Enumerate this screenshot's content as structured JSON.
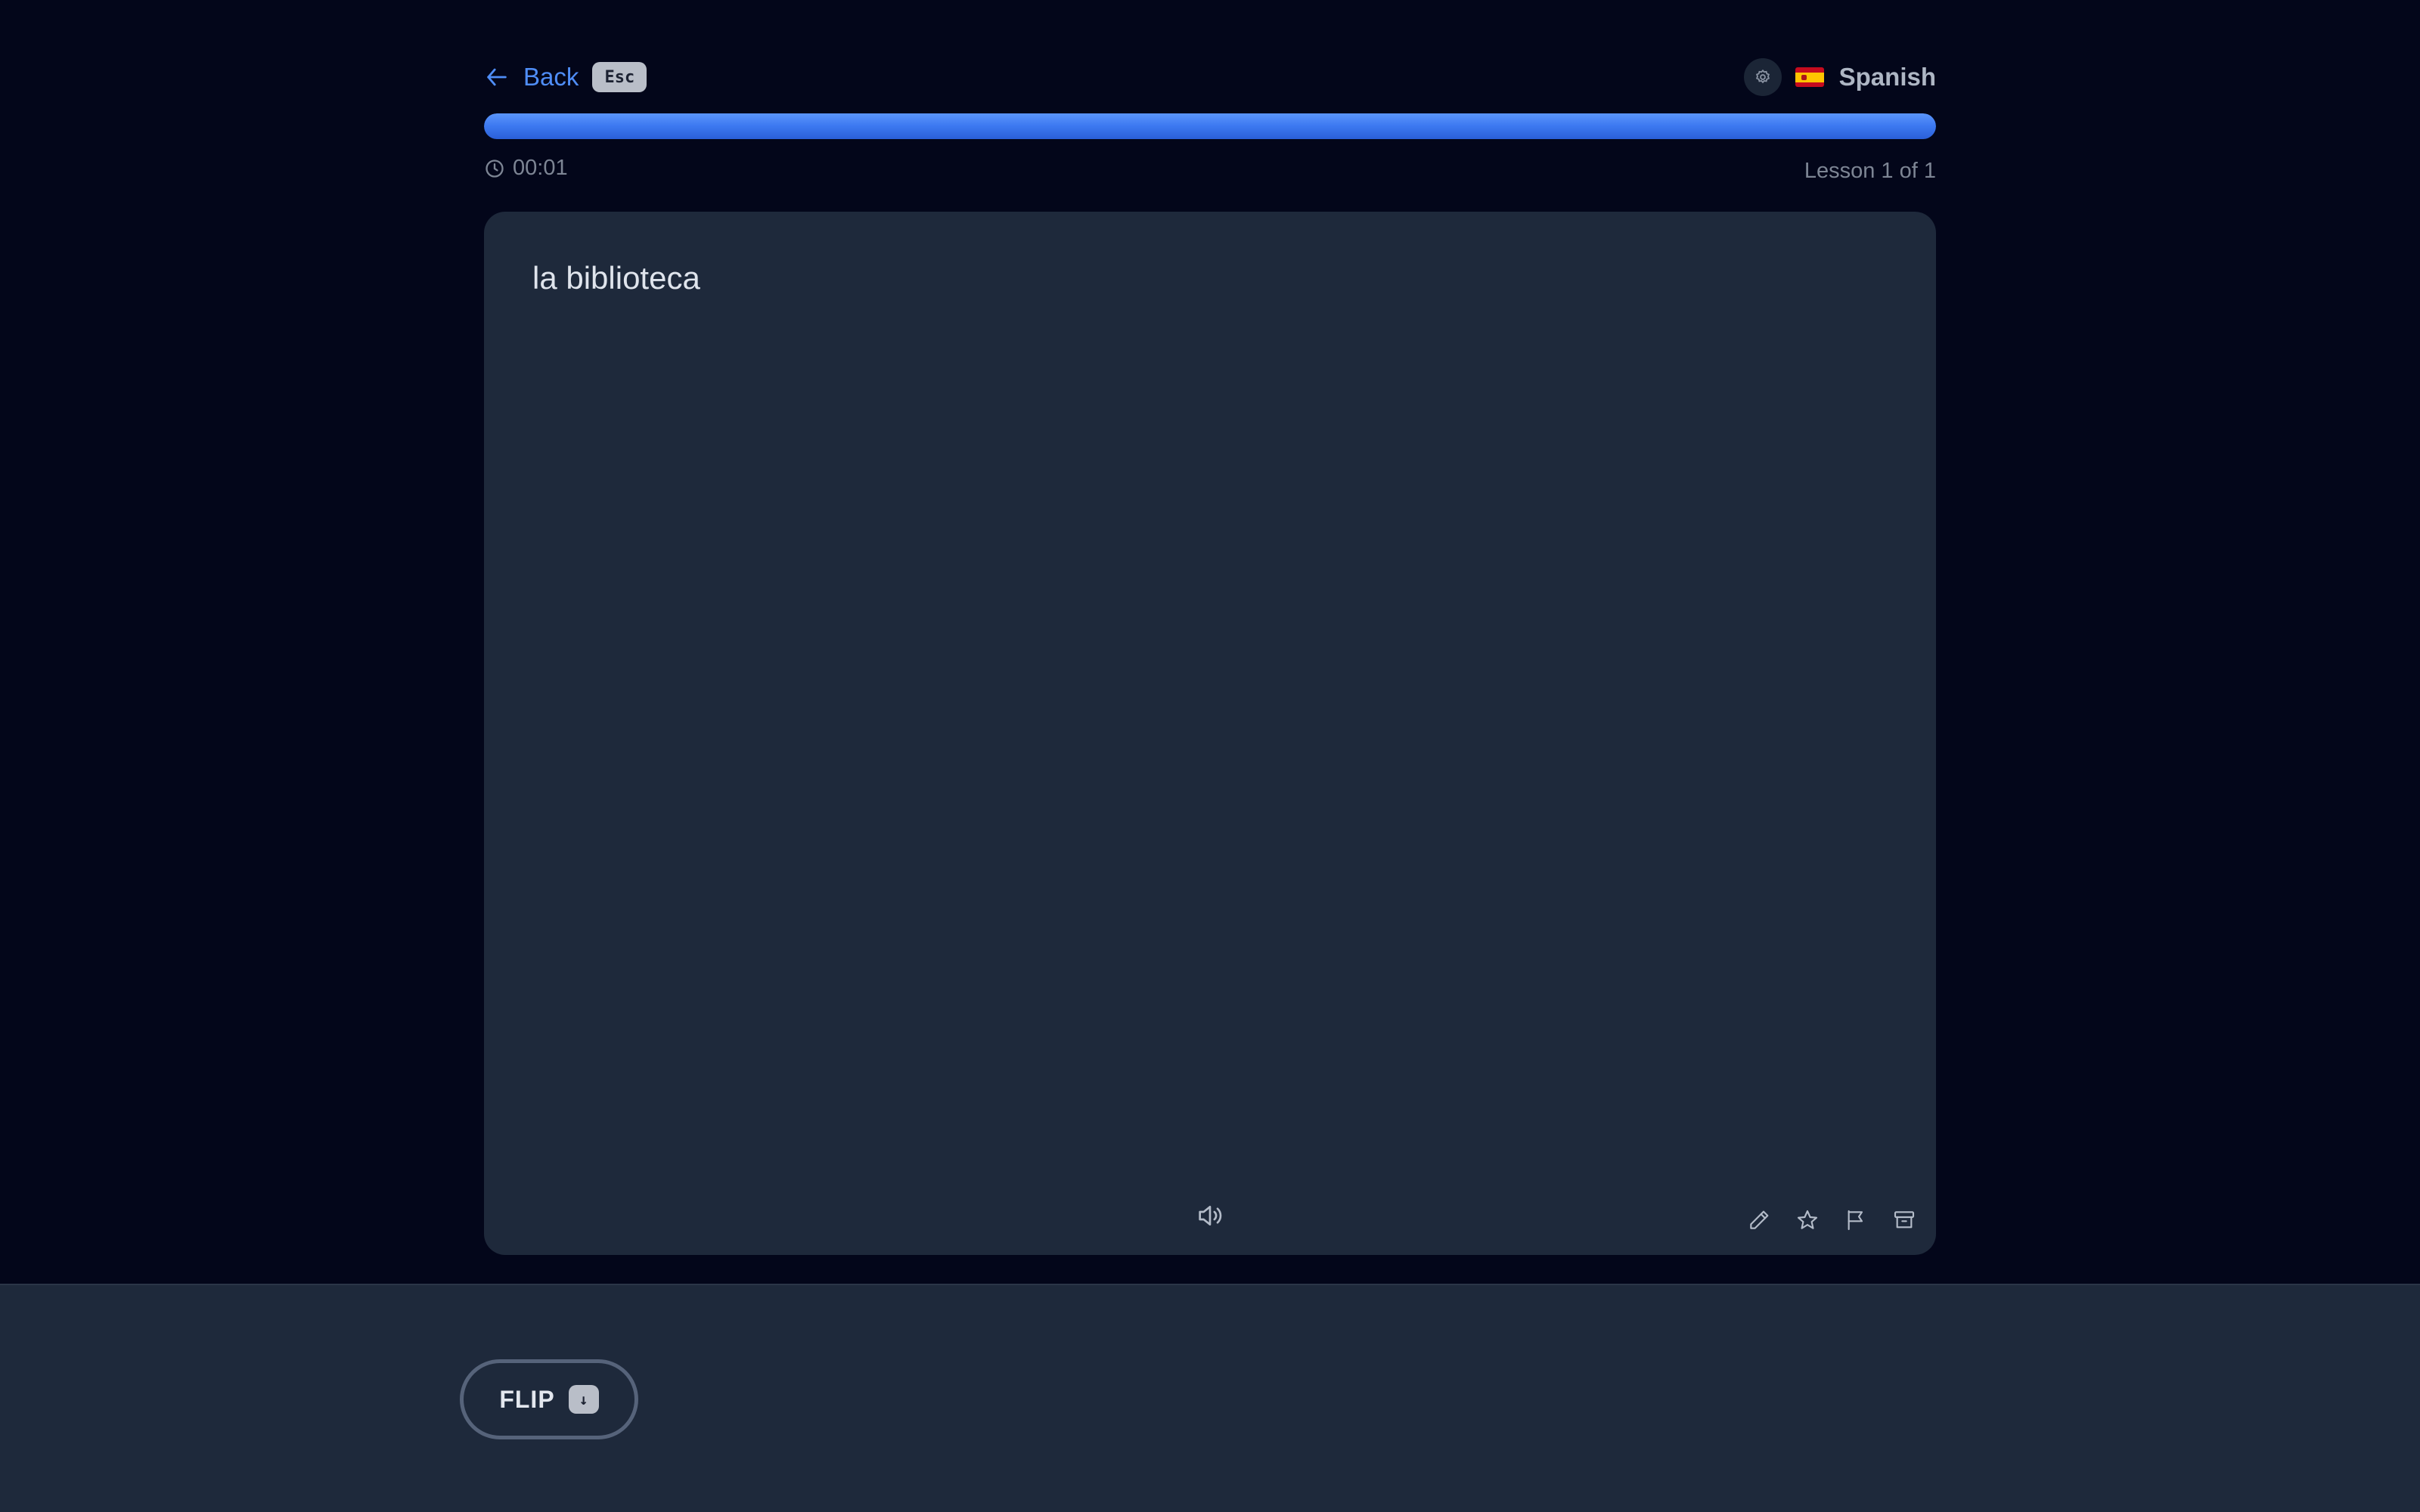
{
  "header": {
    "back_label": "Back",
    "back_shortcut": "Esc",
    "settings_icon": "settings-icon",
    "language_flag": "spain-flag-icon",
    "language_name": "Spanish"
  },
  "progress": {
    "fraction": 1.0,
    "color": "#3c78f0"
  },
  "meta": {
    "timer": "00:01",
    "lesson_count": "Lesson 1 of 1"
  },
  "card": {
    "term": "la biblioteca",
    "actions": [
      "speaker-icon",
      "pencil-icon",
      "star-icon",
      "flag-icon",
      "archive-icon"
    ]
  },
  "footer": {
    "flip_label": "FLIP",
    "flip_shortcut": "↓"
  },
  "colors": {
    "background": "#03061a",
    "card": "#1e293b",
    "accent": "#4f8df7"
  }
}
